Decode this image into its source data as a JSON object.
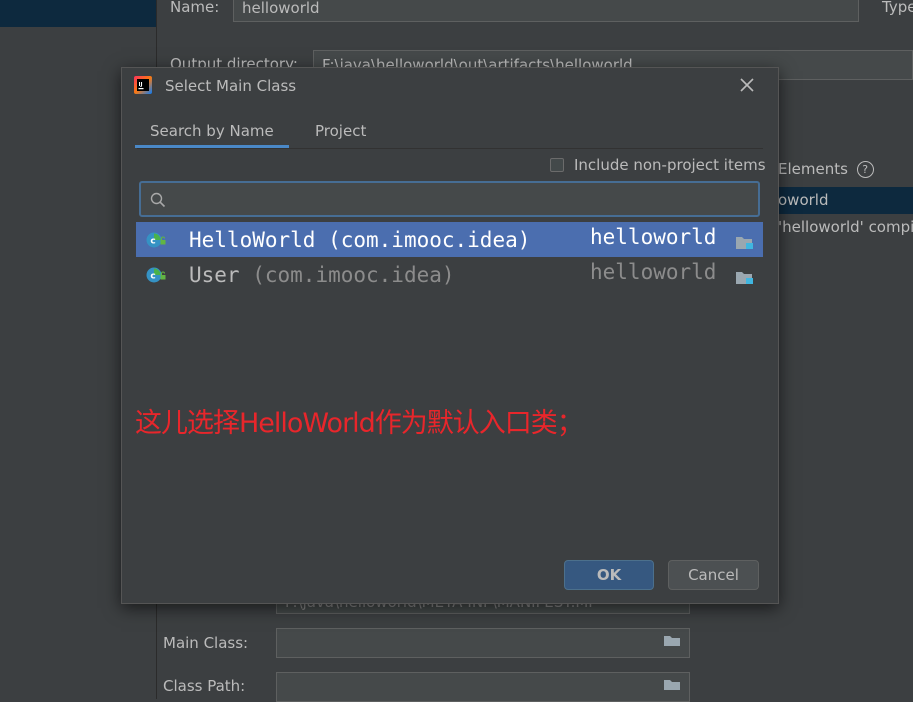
{
  "background": {
    "name_label": "Name:",
    "name_value": "helloworld",
    "type_label": "Type",
    "output_label": "Output directory:",
    "output_value": "F:\\java\\helloworld\\out\\artifacts\\helloworld",
    "elements_label": "Elements",
    "right_row1": "oworld",
    "right_row2": "'helloworld' compil",
    "manifest_value": "F:\\java\\helloworld\\META-INF\\MANIFEST.MF",
    "main_class_label": "Main Class:",
    "main_class_value": "",
    "class_path_label": "Class Path:",
    "class_path_value": ""
  },
  "dialog": {
    "title": "Select Main Class",
    "tabs": [
      {
        "label": "Search by Name",
        "active": true
      },
      {
        "label": "Project",
        "active": false
      }
    ],
    "include_non_project_label": "Include non-project items",
    "include_non_project_checked": false,
    "search": {
      "value": "",
      "placeholder": ""
    },
    "results": [
      {
        "name": "HelloWorld",
        "package": "(com.imooc.idea)",
        "module": "helloworld",
        "selected": true
      },
      {
        "name": "User",
        "package": "(com.imooc.idea)",
        "module": "helloworld",
        "selected": false
      }
    ],
    "annotation": "这儿选择HelloWorld作为默认入口类；",
    "ok_label": "OK",
    "cancel_label": "Cancel"
  },
  "colors": {
    "background": "#3c3f41",
    "selection": "#4b6eaf",
    "annotation": "#e8262b",
    "ok_button": "#365880"
  },
  "icons": [
    "intellij-logo-icon",
    "close-icon",
    "search-icon",
    "class-icon",
    "module-folder-icon",
    "folder-icon",
    "help-icon"
  ]
}
